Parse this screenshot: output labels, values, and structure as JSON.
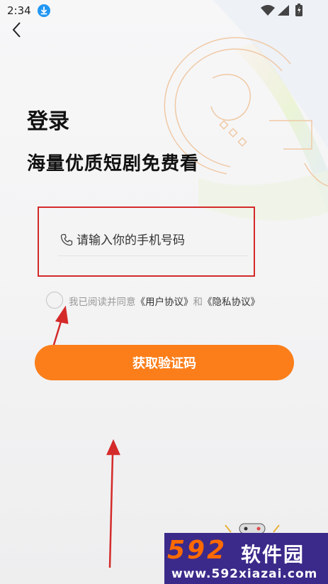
{
  "status_bar": {
    "time": "2:34"
  },
  "page": {
    "title": "登录",
    "subtitle": "海量优质短剧免费看"
  },
  "phone": {
    "placeholder": "请输入你的手机号码",
    "value": ""
  },
  "agreement": {
    "prefix": "我已阅读并同意",
    "user_agreement": "《用户协议》",
    "conjunction": "和",
    "privacy_policy": "《隐私协议》",
    "checked": false
  },
  "buttons": {
    "get_code": "获取验证码"
  },
  "watermark": {
    "logo": "592",
    "site": "软件园",
    "url": "www.592xiazai.com"
  },
  "colors": {
    "accent": "#fb7e1a",
    "annotation": "#d42a2a"
  }
}
